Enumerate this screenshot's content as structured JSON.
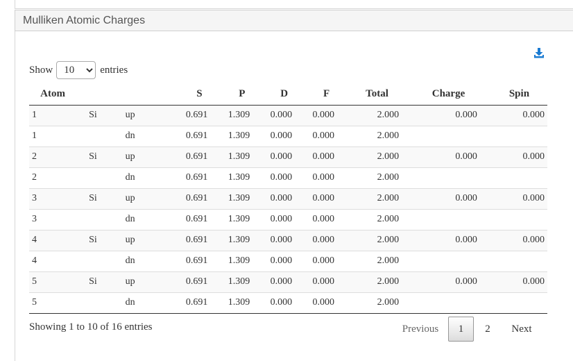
{
  "panel": {
    "title": "Mulliken Atomic Charges"
  },
  "length": {
    "show_label": "Show",
    "selected": "10",
    "entries_label": "entries"
  },
  "table": {
    "headers": {
      "atom": "Atom",
      "s": "S",
      "p": "P",
      "d": "D",
      "f": "F",
      "total": "Total",
      "charge": "Charge",
      "spin": "Spin"
    },
    "rows": [
      [
        "1",
        "Si",
        "up",
        "0.691",
        "1.309",
        "0.000",
        "0.000",
        "2.000",
        "0.000",
        "0.000"
      ],
      [
        "1",
        "",
        "dn",
        "0.691",
        "1.309",
        "0.000",
        "0.000",
        "2.000",
        "",
        ""
      ],
      [
        "2",
        "Si",
        "up",
        "0.691",
        "1.309",
        "0.000",
        "0.000",
        "2.000",
        "0.000",
        "0.000"
      ],
      [
        "2",
        "",
        "dn",
        "0.691",
        "1.309",
        "0.000",
        "0.000",
        "2.000",
        "",
        ""
      ],
      [
        "3",
        "Si",
        "up",
        "0.691",
        "1.309",
        "0.000",
        "0.000",
        "2.000",
        "0.000",
        "0.000"
      ],
      [
        "3",
        "",
        "dn",
        "0.691",
        "1.309",
        "0.000",
        "0.000",
        "2.000",
        "",
        ""
      ],
      [
        "4",
        "Si",
        "up",
        "0.691",
        "1.309",
        "0.000",
        "0.000",
        "2.000",
        "0.000",
        "0.000"
      ],
      [
        "4",
        "",
        "dn",
        "0.691",
        "1.309",
        "0.000",
        "0.000",
        "2.000",
        "",
        ""
      ],
      [
        "5",
        "Si",
        "up",
        "0.691",
        "1.309",
        "0.000",
        "0.000",
        "2.000",
        "0.000",
        "0.000"
      ],
      [
        "5",
        "",
        "dn",
        "0.691",
        "1.309",
        "0.000",
        "0.000",
        "2.000",
        "",
        ""
      ]
    ]
  },
  "info": {
    "text": "Showing 1 to 10 of 16 entries"
  },
  "pagination": {
    "previous": "Previous",
    "page1": "1",
    "page2": "2",
    "next": "Next"
  },
  "icons": {
    "download": "download-icon"
  },
  "colors": {
    "accent": "#1a7bd2"
  }
}
